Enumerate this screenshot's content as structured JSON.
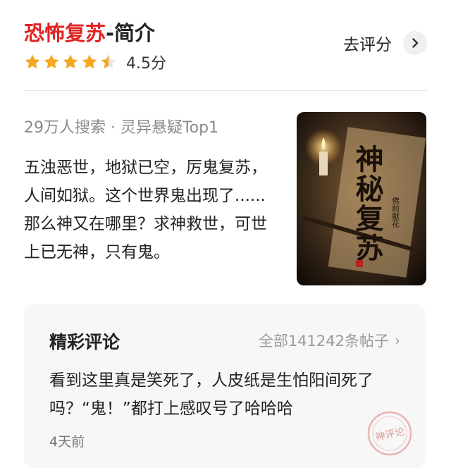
{
  "header": {
    "title_red": "恐怖复苏",
    "title_rest": "-简介",
    "rating": 4.5,
    "rating_text": "4.5分",
    "rate_button_label": "去评分"
  },
  "book": {
    "meta": "29万人搜索 · 灵异悬疑Top1",
    "synopsis": "五浊恶世，地狱已空，厉鬼复苏，人间如狱。这个世界鬼出现了......那么神又在哪里？求神救世，可世上已无神，只有鬼。",
    "cover_title": "神秘复苏",
    "cover_author": "佛前献花"
  },
  "comments": {
    "section_title": "精彩评论",
    "all_link": "全部141242条帖子",
    "top_comment": "看到这里真是笑死了，人皮纸是生怕阳间死了吗？“鬼！”都打上感叹号了哈哈哈",
    "time": "4天前",
    "stamp_text": "神评论"
  },
  "colors": {
    "accent_red": "#e02323",
    "star": "#f5a623"
  }
}
